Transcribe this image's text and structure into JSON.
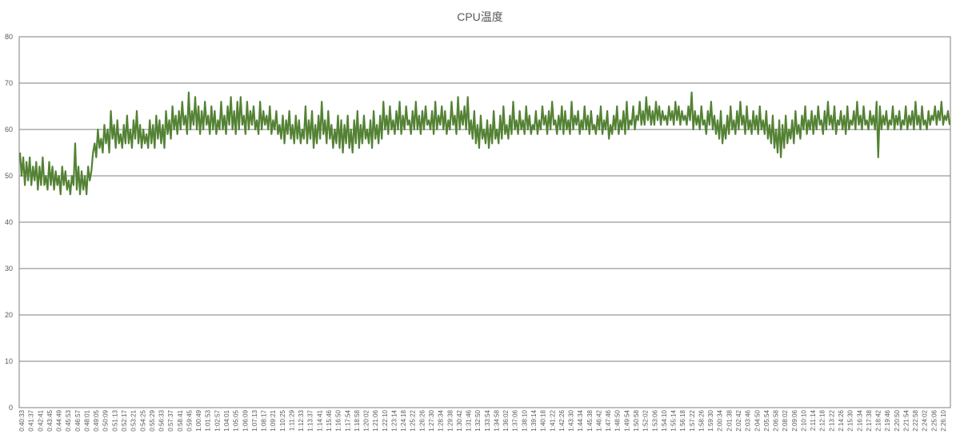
{
  "chart_data": {
    "type": "line",
    "title": "CPU温度",
    "xlabel": "",
    "ylabel": "",
    "ylim": [
      0,
      80
    ],
    "yticks": [
      0,
      10,
      20,
      30,
      40,
      50,
      60,
      70,
      80
    ],
    "grid": true,
    "legend": "none",
    "series_color": "#548235",
    "gridline_color": "#7f7f7f",
    "x_start": "0:40:33",
    "x_end": "2:26:14",
    "x_tick_labels": [
      "0:40:33",
      "0:41:37",
      "0:42:41",
      "0:43:45",
      "0:44:49",
      "0:45:53",
      "0:46:57",
      "0:48:01",
      "0:49:05",
      "0:50:09",
      "0:51:13",
      "0:52:17",
      "0:53:21",
      "0:54:25",
      "0:55:29",
      "0:56:33",
      "0:57:37",
      "0:58:41",
      "0:59:45",
      "1:00:49",
      "1:01:53",
      "1:02:57",
      "1:04:01",
      "1:05:05",
      "1:06:09",
      "1:07:13",
      "1:08:17",
      "1:09:21",
      "1:10:25",
      "1:11:29",
      "1:12:33",
      "1:13:37",
      "1:14:41",
      "1:15:46",
      "1:16:50",
      "1:17:54",
      "1:18:58",
      "1:20:02",
      "1:21:06",
      "1:22:10",
      "1:23:14",
      "1:24:18",
      "1:25:22",
      "1:26:26",
      "1:27:30",
      "1:28:34",
      "1:29:38",
      "1:30:42",
      "1:31:46",
      "1:32:50",
      "1:33:54",
      "1:34:58",
      "1:36:02",
      "1:37:06",
      "1:38:10",
      "1:39:14",
      "1:40:18",
      "1:41:22",
      "1:42:26",
      "1:43:30",
      "1:44:34",
      "1:45:38",
      "1:46:42",
      "1:47:46",
      "1:48:50",
      "1:49:54",
      "1:50:58",
      "1:52:02",
      "1:53:06",
      "1:54:10",
      "1:55:14",
      "1:56:18",
      "1:57:22",
      "1:58:26",
      "1:59:30",
      "2:00:34",
      "2:01:38",
      "2:02:42",
      "2:03:46",
      "2:04:50",
      "2:05:54",
      "2:06:58",
      "2:08:02",
      "2:09:06",
      "2:10:10",
      "2:11:14",
      "2:12:18",
      "2:13:22",
      "2:14:26",
      "2:15:30",
      "2:16:34",
      "2:17:38",
      "2:18:42",
      "2:19:46",
      "2:20:50",
      "2:21:54",
      "2:22:58",
      "2:24:02",
      "2:25:06",
      "2:26:10"
    ],
    "series": [
      {
        "values": [
          55,
          50,
          54,
          48,
          53,
          49,
          54,
          48,
          52,
          49,
          53,
          47,
          52,
          48,
          54,
          48,
          50,
          47,
          53,
          48,
          52,
          47,
          51,
          48,
          50,
          46,
          52,
          48,
          51,
          47,
          49,
          46,
          50,
          48,
          57,
          47,
          52,
          46,
          51,
          47,
          50,
          46,
          52,
          49,
          51,
          55,
          57,
          54,
          60,
          56,
          58,
          55,
          61,
          57,
          60,
          55,
          64,
          58,
          61,
          56,
          62,
          57,
          59,
          56,
          61,
          57,
          63,
          57,
          60,
          56,
          62,
          58,
          64,
          57,
          61,
          56,
          60,
          57,
          59,
          56,
          62,
          57,
          61,
          56,
          63,
          58,
          62,
          57,
          61,
          56,
          64,
          59,
          62,
          58,
          65,
          60,
          63,
          59,
          64,
          60,
          66,
          61,
          63,
          59,
          68,
          60,
          64,
          61,
          67,
          60,
          65,
          59,
          64,
          60,
          66,
          61,
          63,
          59,
          65,
          60,
          64,
          59,
          62,
          60,
          66,
          60,
          63,
          59,
          65,
          61,
          67,
          60,
          64,
          59,
          66,
          60,
          67,
          61,
          63,
          59,
          66,
          60,
          64,
          61,
          65,
          60,
          62,
          59,
          66,
          60,
          64,
          61,
          63,
          60,
          65,
          59,
          62,
          60,
          64,
          59,
          61,
          58,
          63,
          57,
          62,
          59,
          64,
          58,
          61,
          57,
          63,
          58,
          62,
          57,
          60,
          58,
          65,
          57,
          62,
          58,
          64,
          56,
          61,
          57,
          63,
          58,
          66,
          59,
          62,
          57,
          64,
          58,
          61,
          56,
          60,
          57,
          63,
          56,
          62,
          55,
          61,
          57,
          63,
          56,
          60,
          55,
          62,
          57,
          64,
          56,
          61,
          57,
          63,
          58,
          60,
          57,
          62,
          56,
          64,
          58,
          61,
          57,
          63,
          58,
          66,
          60,
          63,
          59,
          65,
          60,
          62,
          59,
          64,
          60,
          66,
          59,
          63,
          60,
          65,
          61,
          62,
          59,
          64,
          60,
          66,
          60,
          63,
          59,
          64,
          60,
          65,
          61,
          62,
          60,
          64,
          59,
          66,
          60,
          63,
          61,
          65,
          60,
          64,
          59,
          62,
          60,
          66,
          61,
          63,
          59,
          67,
          60,
          64,
          61,
          65,
          60,
          67,
          59,
          62,
          58,
          64,
          57,
          61,
          56,
          63,
          58,
          60,
          57,
          62,
          56,
          61,
          57,
          64,
          58,
          60,
          57,
          63,
          58,
          65,
          59,
          61,
          58,
          63,
          59,
          66,
          60,
          62,
          59,
          64,
          60,
          62,
          59,
          65,
          60,
          63,
          59,
          61,
          60,
          64,
          59,
          62,
          60,
          65,
          61,
          63,
          59,
          64,
          60,
          66,
          61,
          62,
          59,
          63,
          60,
          65,
          59,
          64,
          60,
          62,
          59,
          66,
          60,
          63,
          61,
          64,
          59,
          62,
          60,
          65,
          60,
          63,
          59,
          64,
          60,
          61,
          59,
          63,
          60,
          65,
          59,
          62,
          60,
          64,
          58,
          61,
          59,
          63,
          60,
          65,
          59,
          62,
          60,
          64,
          59,
          66,
          60,
          62,
          61,
          65,
          60,
          63,
          62,
          66,
          61,
          64,
          61,
          67,
          62,
          65,
          61,
          64,
          61,
          66,
          62,
          65,
          61,
          64,
          62,
          63,
          61,
          65,
          62,
          64,
          61,
          66,
          62,
          65,
          61,
          64,
          62,
          63,
          61,
          65,
          62,
          68,
          60,
          64,
          61,
          63,
          60,
          65,
          61,
          62,
          59,
          64,
          61,
          66,
          60,
          63,
          59,
          62,
          58,
          64,
          57,
          61,
          58,
          63,
          59,
          65,
          60,
          62,
          59,
          64,
          60,
          66,
          61,
          63,
          59,
          65,
          60,
          62,
          59,
          64,
          60,
          63,
          59,
          65,
          60,
          62,
          59,
          64,
          58,
          61,
          57,
          63,
          56,
          60,
          55,
          62,
          54,
          61,
          56,
          63,
          57,
          60,
          58,
          62,
          57,
          64,
          59,
          61,
          58,
          63,
          60,
          65,
          59,
          62,
          60,
          64,
          59,
          63,
          60,
          65,
          61,
          62,
          59,
          64,
          60,
          66,
          61,
          63,
          60,
          65,
          59,
          62,
          61,
          64,
          60,
          63,
          59,
          65,
          60,
          62,
          61,
          64,
          60,
          66,
          61,
          63,
          60,
          65,
          61,
          62,
          60,
          64,
          61,
          63,
          60,
          66,
          54,
          65,
          60,
          63,
          61,
          64,
          60,
          62,
          61,
          65,
          60,
          63,
          61,
          64,
          60,
          62,
          61,
          65,
          60,
          63,
          61,
          64,
          60,
          66,
          61,
          63,
          60,
          65,
          61,
          62,
          60,
          64,
          61,
          63,
          62,
          65,
          61,
          64,
          62,
          66,
          61,
          63,
          62,
          64,
          61
        ]
      }
    ]
  }
}
